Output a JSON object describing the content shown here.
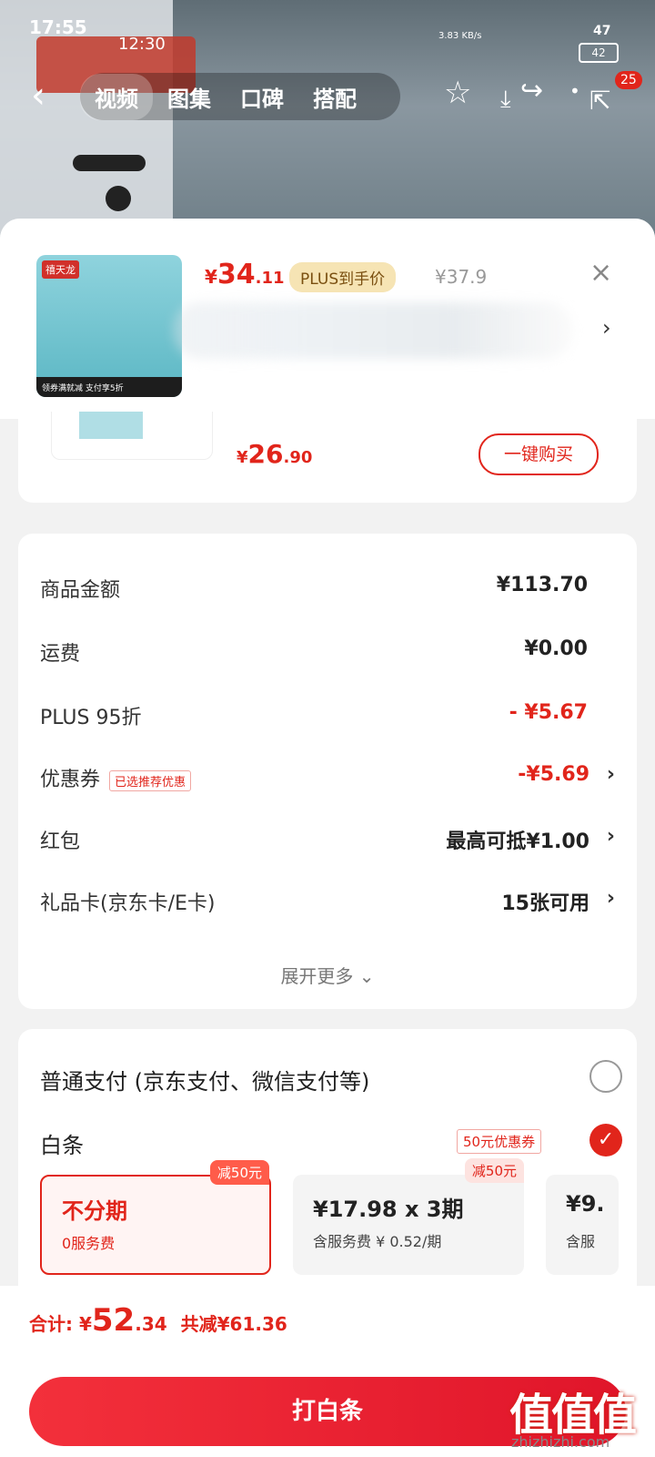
{
  "status_bar": {
    "time_primary": "17:55",
    "time_secondary": "12:30",
    "net_speed": "3.83 KB/s",
    "battery_level": "47",
    "battery_inner": "42"
  },
  "topnav": {
    "back_icon": "chevron-left",
    "tabs": [
      {
        "label": "视频",
        "active": true
      },
      {
        "label": "图集",
        "active": false
      },
      {
        "label": "口碑",
        "active": false
      },
      {
        "label": "搭配",
        "active": false
      }
    ],
    "icons": [
      "star-outline",
      "share",
      "download",
      "more",
      "share-external"
    ],
    "badge_count": "25"
  },
  "product_header": {
    "thumb_brand": "禧天龙",
    "thumb_caption": "领券满就减 支付享5折",
    "price_currency": "¥",
    "price_int": "34",
    "price_dec": ".11",
    "plus_tag": "PLUS到手价",
    "original_price": "¥37.9",
    "close_icon": "×",
    "chevron": "›"
  },
  "product_card": {
    "price_currency": "¥",
    "price_int": "26",
    "price_dec": ".90",
    "buy_button": "一键购买"
  },
  "summary": {
    "rows": [
      {
        "label": "商品金额",
        "value": "¥113.70",
        "red": false,
        "arrow": false,
        "tag": ""
      },
      {
        "label": "运费",
        "value": "¥0.00",
        "red": false,
        "arrow": false,
        "tag": ""
      },
      {
        "label": "PLUS 95折",
        "value": "- ¥5.67",
        "red": true,
        "arrow": false,
        "tag": ""
      },
      {
        "label": "优惠券",
        "value": "-¥5.69",
        "red": true,
        "arrow": true,
        "tag": "已选推荐优惠"
      },
      {
        "label": "红包",
        "value": "最高可抵¥1.00",
        "red": false,
        "arrow": true,
        "tag": ""
      },
      {
        "label": "礼品卡(京东卡/E卡)",
        "value": "15张可用",
        "red": false,
        "arrow": true,
        "tag": ""
      }
    ],
    "expand_more": "展开更多 ⌄"
  },
  "payment": {
    "normal_label": "普通支付 (京东支付、微信支付等)",
    "baitiao_label": "白条",
    "baitiao_coupon": "50元优惠券",
    "check_icon": "✓",
    "plans": [
      {
        "title": "不分期",
        "sub": "0服务费",
        "badge": "减50元",
        "selected": true
      },
      {
        "title": "¥17.98 x 3期",
        "sub": "含服务费 ¥ 0.52/期",
        "badge": "减50元",
        "selected": false
      },
      {
        "title": "¥9.",
        "sub": "含服",
        "badge": "",
        "selected": false
      }
    ]
  },
  "footer": {
    "total_label": "合计: ¥",
    "total_int": "52",
    "total_dec": ".34",
    "saved": "共减¥61.36",
    "pay_button": "打白条"
  },
  "watermark": {
    "logo": "值值值",
    "site": "zhizhizhi.com"
  },
  "colors": {
    "accent": "#e1251b",
    "plus_gold": "#f6e4b4"
  }
}
